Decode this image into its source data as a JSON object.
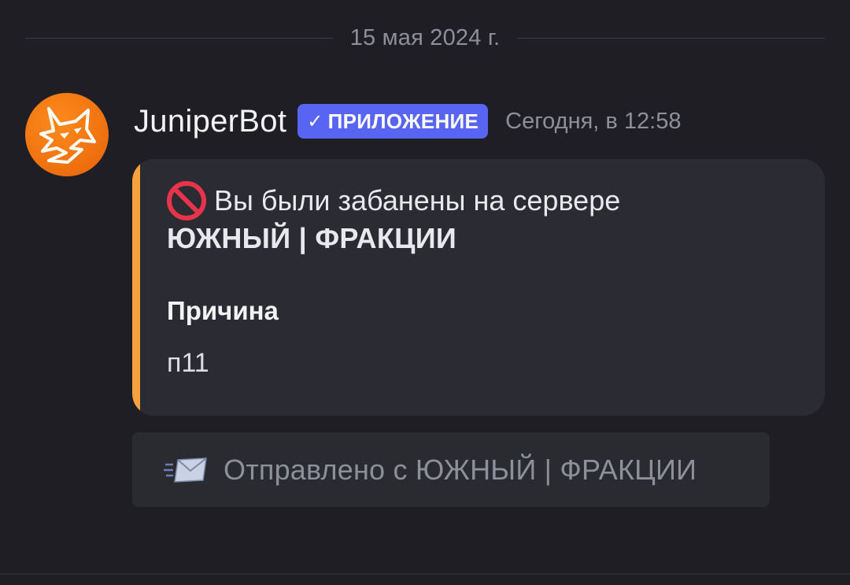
{
  "date_divider": "15 мая 2024 г.",
  "message": {
    "author": "JuniperBot",
    "badge": "ПРИЛОЖЕНИЕ",
    "badge_check": "✓",
    "timestamp": "Сегодня, в 12:58",
    "avatar_icon": "fox-logo-icon"
  },
  "embed": {
    "accent_color": "#f5a13d",
    "icon": "no-entry-icon",
    "title": "Вы были забанены на сервере",
    "server_name": "ЮЖНЫЙ | ФРАКЦИИ",
    "field_name": "Причина",
    "field_value": "п11"
  },
  "footer": {
    "icon": "incoming-envelope-icon",
    "text": "Отправлено с ЮЖНЫЙ | ФРАКЦИИ"
  },
  "colors": {
    "background": "#1e1e24",
    "badge": "#5865f2",
    "embed_bg": "#2b2c33"
  }
}
